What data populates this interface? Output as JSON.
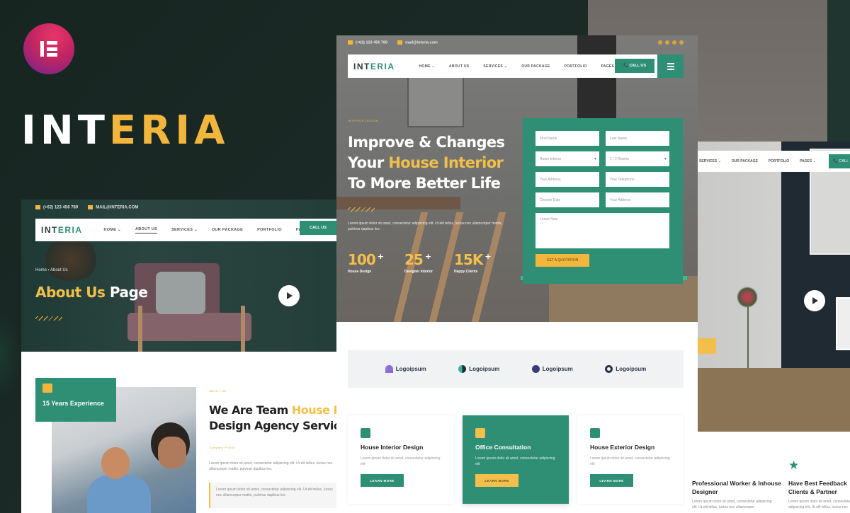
{
  "brand": {
    "name_part1": "INT",
    "name_part2": "ERIA",
    "badge": "elementor-logo"
  },
  "colors": {
    "primary_green": "#2e8f74",
    "accent_yellow": "#f2b63c",
    "dark_bg": "#1c2b27"
  },
  "about_mockup": {
    "topbar": {
      "phone": "(+62) 123 456 789",
      "email": "MAIL@INTERIA.COM"
    },
    "nav": {
      "logo_part1": "INT",
      "logo_part2": "ERIA",
      "items": [
        "HOME ⌄",
        "ABOUT US",
        "SERVICES ⌄",
        "OUR PACKAGE",
        "PORTFOLIO",
        "PAGES ⌄"
      ],
      "call_label": "CALL US"
    },
    "breadcrumb": "Home  ›  About Us",
    "title_part1": "About Us",
    "title_part2": " Page",
    "experience_badge": "15 Years Experience",
    "section_tag": "ABOUT US",
    "heading_line1_part1": "We Are Team ",
    "heading_line1_part2": "House Interior",
    "heading_line2": "Design Agency Services",
    "subtag": "Company Profile",
    "paragraph": "Lorem ipsum dolor sit amet, consectetur adipiscing elit. Ut elit tellus, luctus nec ullamcorper mattis, pulvinar dapibus leo.",
    "quote": "Lorem ipsum dolor sit amet, consectetur adipiscing elit. Ut elit tellus, luctus nec ullamcorper mattis, pulvinar dapibus leo."
  },
  "home_mockup": {
    "topbar": {
      "phone": "(+62) 123 456 789",
      "email": "mail@interia.com"
    },
    "nav": {
      "logo_part1": "INT",
      "logo_part2": "ERIA",
      "items": [
        "HOME ⌄",
        "ABOUT US",
        "SERVICES ⌄",
        "OUR PACKAGE",
        "PORTFOLIO",
        "PAGES ⌄"
      ],
      "call_label": "📞 CALL US"
    },
    "hero": {
      "tag": "INTERIOR DESIGN",
      "line1": "Improve & Changes",
      "line2_part1": "Your ",
      "line2_part2": "House Interior",
      "line3": "To More Better Life",
      "paragraph": "Lorem ipsum dolor sit amet, consectetur adipiscing elit. Ut elit tellus, luctus nec ullamcorper mattis, pulvinar dapibus leo.",
      "stats": [
        {
          "value": "100",
          "suffix": "+",
          "label": "House Design"
        },
        {
          "value": "25",
          "suffix": "+",
          "label": "Designer Interior"
        },
        {
          "value": "15K",
          "suffix": "+",
          "label": "Happy Clients"
        }
      ]
    },
    "form": {
      "first_name": "First Name",
      "last_name": "Last Name",
      "room_select": "Room Interior",
      "rooms_select": "1 / 2 Rooms",
      "email": "Your Address",
      "phone": "Your Telephone",
      "date": "Choose Date",
      "address": "Your Address",
      "note": "Leave Note",
      "submit": "GET A QUOTATION"
    },
    "logos": [
      "Logoipsum",
      "Logoipsum",
      "Logoipsum",
      "Logoipsum"
    ],
    "services": [
      {
        "title": "House Interior Design",
        "desc": "Lorem ipsum dolor sit amet, consectetur adipiscing elit",
        "button": "LEARN MORE",
        "icon": "paint-roller-icon"
      },
      {
        "title": "Office Consultation",
        "desc": "Lorem ipsum dolor sit amet, consectetur adipiscing elit",
        "button": "LEARN MORE",
        "icon": "shop-icon"
      },
      {
        "title": "House Exterior Design",
        "desc": "Lorem ipsum dolor sit amet, consectetur adipiscing elit",
        "button": "LEARN MORE",
        "icon": "garage-icon"
      }
    ]
  },
  "right_mockup": {
    "nav_items": [
      "SERVICES ⌄",
      "OUR PACKAGE",
      "PORTFOLIO",
      "PAGES ⌄"
    ],
    "call_label": "📞 CALL",
    "features": [
      {
        "title": "Professional Worker & Inhouse Designer",
        "desc": "Lorem ipsum dolor sit amet, consectetur adipiscing elit. Ut elit tellus, luctus nec ullamcorper"
      },
      {
        "title": "Have Best Feedback Clients & Partner",
        "desc": "Lorem ipsum dolor sit amet, consectetur adipiscing elit. Ut elit tellus, luctus nec"
      }
    ]
  }
}
